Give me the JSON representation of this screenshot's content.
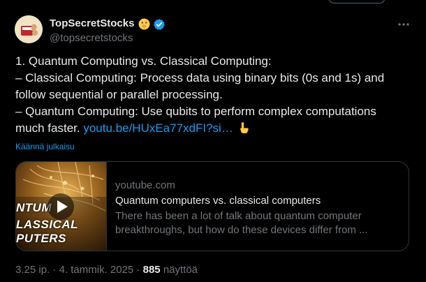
{
  "author": {
    "display_name": "TopSecretStocks",
    "handle": "@topsecretstocks",
    "verified": true,
    "name_emoji": "shushing-face-icon"
  },
  "tweet": {
    "lines": [
      "1. Quantum Computing vs. Classical Computing:",
      "– Classical Computing: Process data using binary bits (0s and 1s) and",
      "follow sequential or parallel processing.",
      "– Quantum Computing: Use qubits to perform complex computations",
      "much faster."
    ],
    "link_text": "youtu.be/HUxEa77xdFI?si…",
    "trailing_emoji": "backhand-index-pointing-down-icon"
  },
  "translate_label": "Käännä julkaisu",
  "card": {
    "domain": "youtube.com",
    "title": "Quantum computers vs. classical computers",
    "description_lines": [
      "There has been a lot of talk about quantum computer",
      "breakthroughs, but how do these devices differ from ..."
    ],
    "thumbnail_words": [
      "NTUM",
      "LASSICAL",
      "PUTERS"
    ]
  },
  "meta": {
    "time": "3.25 ip.",
    "separator": " · ",
    "date": "4. tammik. 2025",
    "views_count": "885",
    "views_label": " näyttöä"
  },
  "colors": {
    "background": "#000000",
    "text": "#e7e9ea",
    "secondary_text": "#71767b",
    "link": "#1d9bf0",
    "border": "#2f3336"
  }
}
